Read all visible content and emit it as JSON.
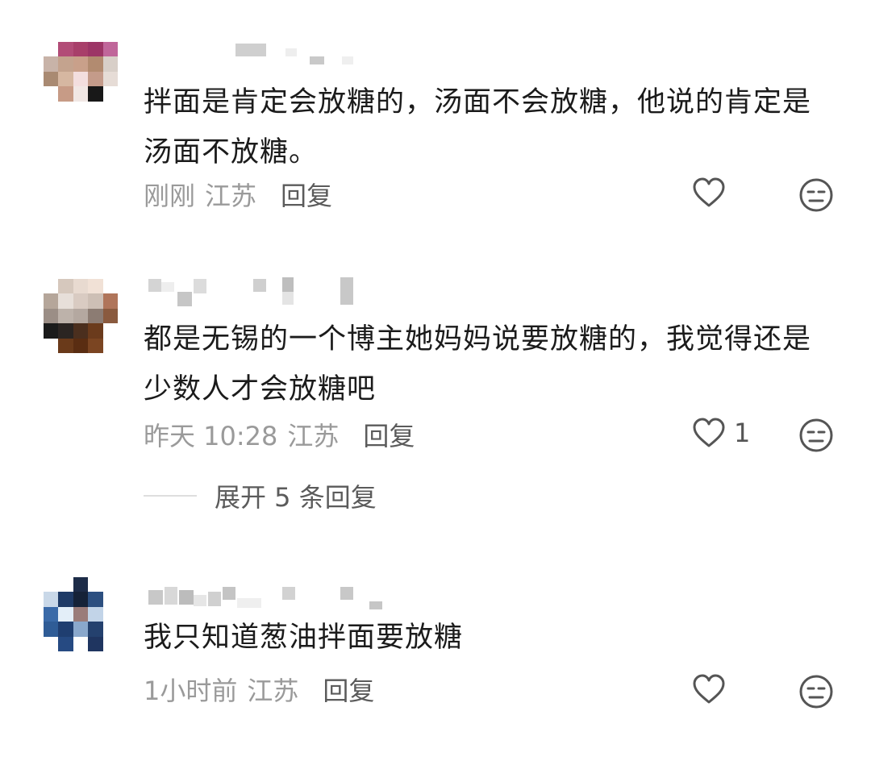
{
  "comments": [
    {
      "text": "拌面是肯定会放糖的，汤面不会放糖，他说的肯定是汤面不放糖。",
      "time": "刚刚",
      "location": "江苏",
      "reply_label": "回复",
      "like_count": "",
      "avatar_colors": [
        "#ffffff",
        "#b24c77",
        "#a83f6a",
        "#9c3566",
        "#c0669a",
        "#c8b3a8",
        "#c4a38e",
        "#c9a08a",
        "#b28b70",
        "#d8cfc8",
        "#a98a72",
        "#d6b7a1",
        "#f3dede",
        "#c49b8a",
        "#e6dcd6",
        "#ffffff",
        "#c79b86",
        "#f1e7e4",
        "#181818",
        "#ffffff",
        "#ffffff",
        "#ffffff",
        "#ffffff",
        "#ffffff",
        "#ffffff"
      ]
    },
    {
      "text": "都是无锡的一个博主她妈妈说要放糖的，我觉得还是少数人才会放糖吧",
      "time": "昨天 10:28",
      "location": "江苏",
      "reply_label": "回复",
      "like_count": "1",
      "expand_label": "展开 5 条回复",
      "avatar_colors": [
        "#ffffff",
        "#d6c8bd",
        "#e8dad0",
        "#f1e1d6",
        "#ffffff",
        "#b5a69a",
        "#e7dfd9",
        "#d9cbc2",
        "#cdbfb5",
        "#b0755a",
        "#9b8e86",
        "#bdb2aa",
        "#b4a8a0",
        "#8c7c73",
        "#8a5a3e",
        "#1b1b1b",
        "#2b2522",
        "#4b2f1e",
        "#6b3b1c",
        "#ffffff",
        "#ffffff",
        "#6a3a1a",
        "#5a2d12",
        "#7b4522",
        "#ffffff"
      ]
    },
    {
      "text": "我只知道葱油拌面要放糖",
      "time": "1小时前",
      "location": "江苏",
      "reply_label": "回复",
      "like_count": "",
      "avatar_colors": [
        "#ffffff",
        "#ffffff",
        "#1d2c48",
        "#ffffff",
        "#ffffff",
        "#c9d8e8",
        "#1e3a66",
        "#152238",
        "#2c4f80",
        "#ffffff",
        "#3a6aa8",
        "#e3eef8",
        "#9a7c7a",
        "#c2d4e8",
        "#ffffff",
        "#2f5c96",
        "#1f3e70",
        "#8aa8cc",
        "#24416e",
        "#ffffff",
        "#ffffff",
        "#264a82",
        "#ffffff",
        "#1f3560",
        "#ffffff"
      ]
    }
  ],
  "icons": {
    "like": "heart-outline-icon",
    "dislike": "meh-face-icon"
  },
  "colors": {
    "text": "#1b1b1b",
    "meta": "#9a9a9a",
    "action": "#5b5b5b",
    "icon": "#555555"
  }
}
